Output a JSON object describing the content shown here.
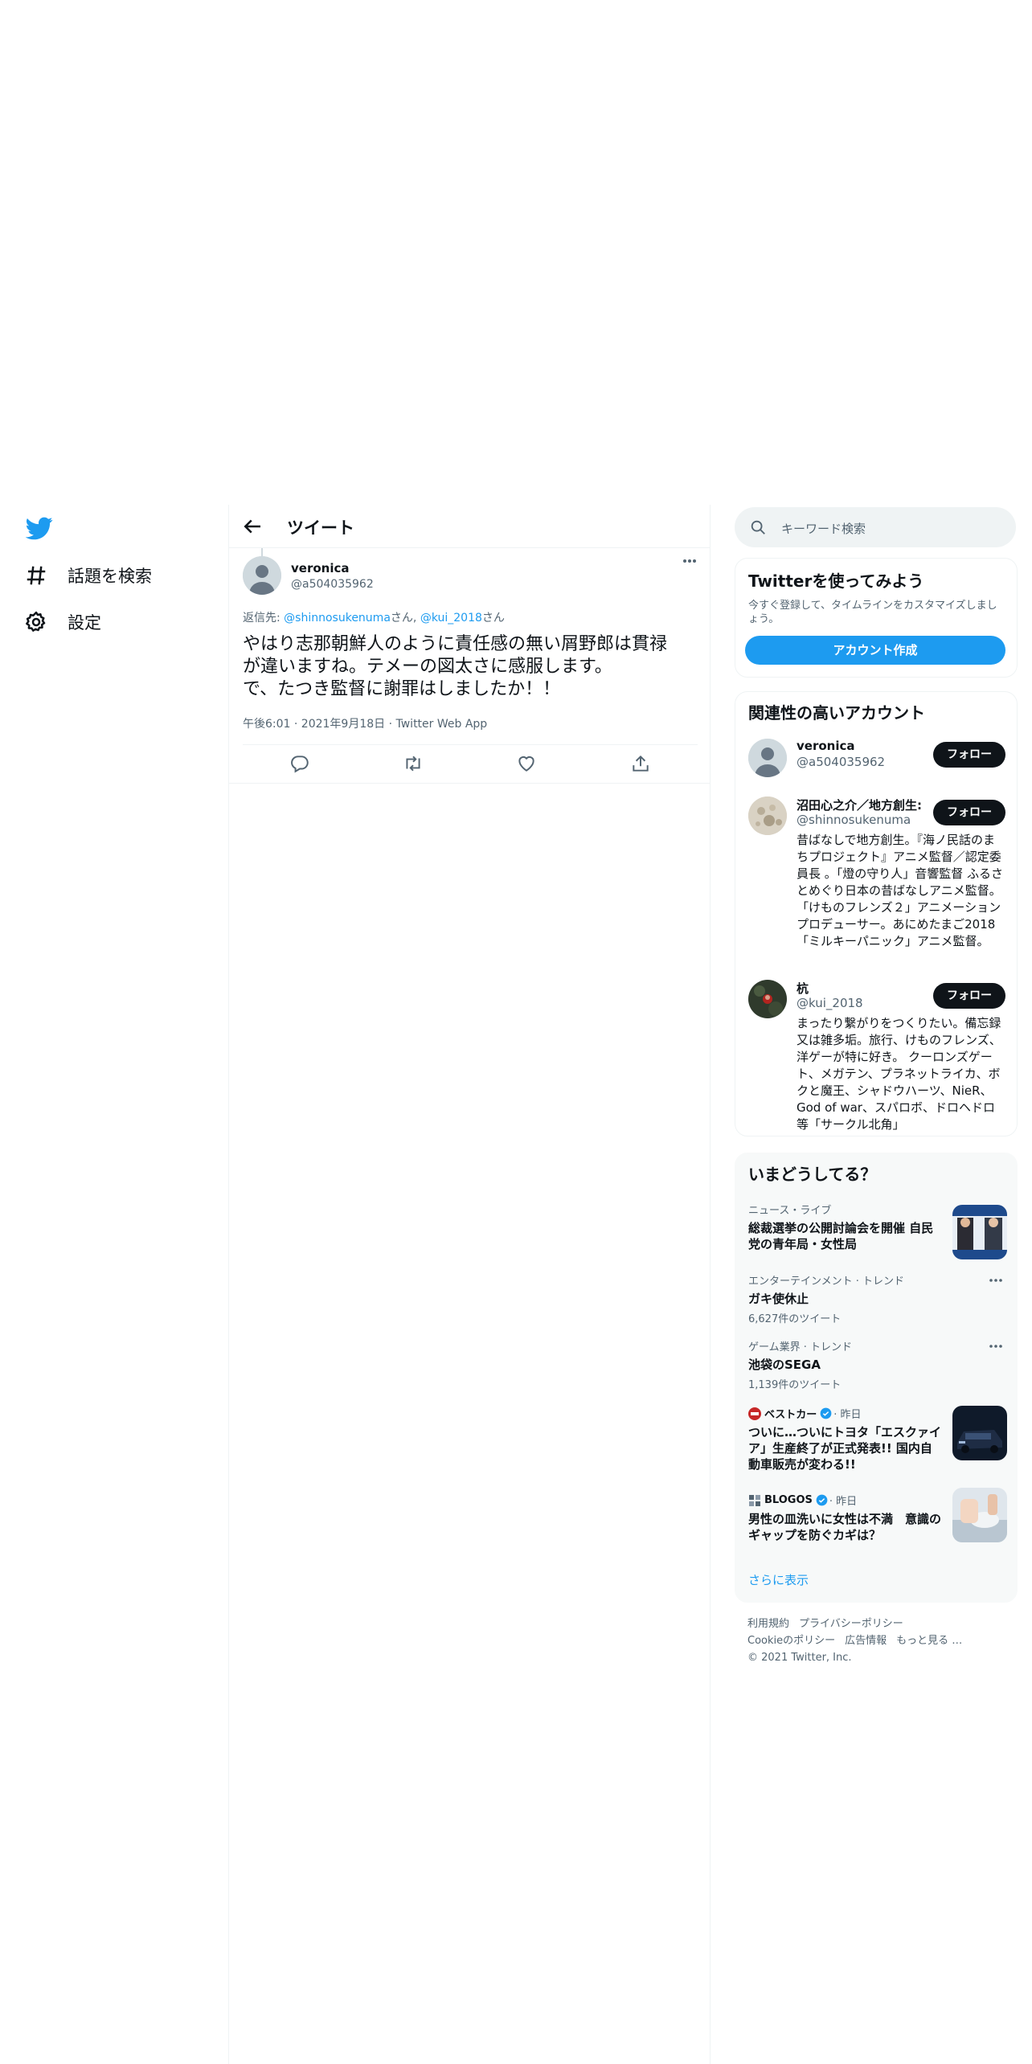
{
  "nav": {
    "items": [
      {
        "label": "話題を検索",
        "icon": "hashtag-icon"
      },
      {
        "label": "設定",
        "icon": "gear-icon"
      }
    ]
  },
  "main": {
    "header_title": "ツイート"
  },
  "tweet": {
    "name": "veronica",
    "handle": "@a504035962",
    "reply_prefix": "返信先: ",
    "reply_user1": "@shinnosukenuma",
    "reply_suffix1": "さん, ",
    "reply_user2": "@kui_2018",
    "reply_suffix2": "さん",
    "text_line1": "やはり志那朝鮮人のように責任感の無い屑野郎は貫禄",
    "text_line2": "が違いますね。テメーの図太さに感服します。",
    "text_line3": "で、たつき監督に謝罪はしましたか！！",
    "meta": "午後6:01 · 2021年9月18日 · Twitter Web App"
  },
  "search": {
    "placeholder": "キーワード検索"
  },
  "signup": {
    "title": "Twitterを使ってみよう",
    "subtitle": "今すぐ登録して、タイムラインをカスタマイズしましょう。",
    "button": "アカウント作成"
  },
  "who_to_follow": {
    "title": "関連性の高いアカウント",
    "follow_label": "フォロー",
    "accounts": [
      {
        "name": "veronica",
        "handle": "@a504035962",
        "bio": ""
      },
      {
        "name": "沼田心之介／地方創生:",
        "handle": "@shinnosukenuma",
        "bio": "昔ばなしで地方創生。『海ノ民話のまちプロジェクト』アニメ監督／認定委員長 。「燈の守り人」音響監督 ふるさとめぐり日本の昔ばなしアニメ監督。「けものフレンズ２」アニメーションプロデューサー。あにめたまご2018「ミルキーパニック」アニメ監督。"
      },
      {
        "name": "杭",
        "handle": "@kui_2018",
        "bio": "まったり繋がりをつくりたい。備忘録又は雑多垢。旅行、けものフレンズ、洋ゲーが特に好き。 クーロンズゲート、メガテン、プラネットライカ、ボクと魔王、シャドウハーツ、NieR、God of war、スパロボ、ドロヘドロ等「サークル北角」"
      }
    ]
  },
  "trends": {
    "title": "いまどうしてる？",
    "items": [
      {
        "category": "ニュース・ライブ",
        "title": "総裁選挙の公開討論会を開催 自民党の青年局・女性局"
      },
      {
        "category": "エンターテインメント · トレンド",
        "title": "ガキ使休止",
        "count": "6,627件のツイート"
      },
      {
        "category": "ゲーム業界 · トレンド",
        "title": "池袋のSEGA",
        "count": "1,139件のツイート"
      },
      {
        "source": "ベストカー",
        "time": "· 昨日",
        "title": "ついに…ついにトヨタ「エスクァイア」生産終了が正式発表!! 国内自動車販売が変わる!!"
      },
      {
        "source": "BLOGOS",
        "time": "· 昨日",
        "title": "男性の皿洗いに女性は不満　意識のギャップを防ぐカギは？"
      }
    ],
    "show_more": "さらに表示"
  },
  "footer": {
    "links": [
      "利用規約",
      "プライバシーポリシー",
      "Cookieのポリシー",
      "広告情報",
      "もっと見る …"
    ],
    "copyright": "© 2021 Twitter, Inc."
  },
  "colors": {
    "accent": "#1d9bf0",
    "text": "#0f1419",
    "secondary": "#536471",
    "border": "#eff3f4"
  }
}
